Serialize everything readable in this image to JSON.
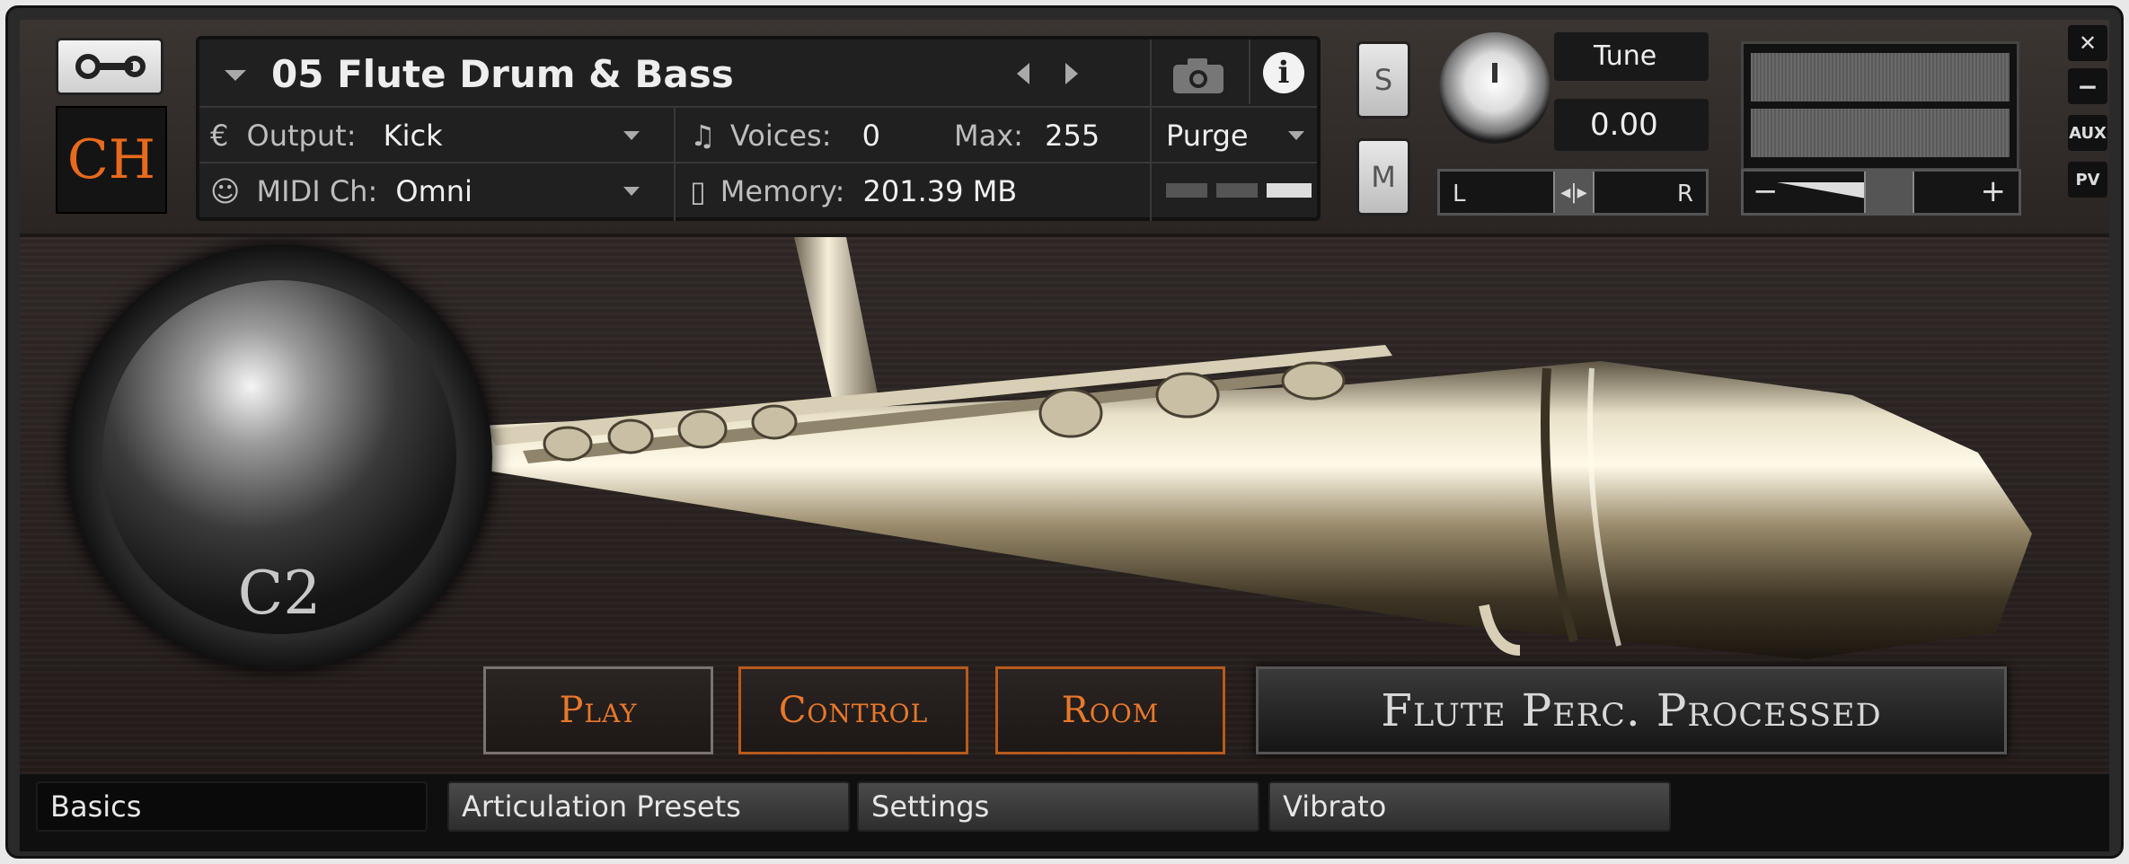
{
  "header": {
    "logo_text": "CH",
    "instrument_name": "05 Flute Drum & Bass",
    "output_label": "Output:",
    "output_value": "Kick",
    "midi_label": "MIDI Ch:",
    "midi_value": "Omni",
    "voices_label": "Voices:",
    "voices_value": "0",
    "max_label": "Max:",
    "max_value": "255",
    "memory_label": "Memory:",
    "memory_value": "201.39 MB",
    "purge_label": "Purge",
    "solo_label": "S",
    "mute_label": "M",
    "tune_label": "Tune",
    "tune_value": "0.00",
    "pan_left": "L",
    "pan_right": "R",
    "vol_minus": "−",
    "vol_plus": "+",
    "close_label": "✕",
    "minimize_label": "−",
    "aux_label": "AUX",
    "pv_label": "PV"
  },
  "main": {
    "note_label": "C2",
    "nav_buttons": [
      "Play",
      "Control",
      "Room"
    ],
    "preset_name": "Flute Perc. Processed"
  },
  "tabs": [
    "Basics",
    "Articulation Presets",
    "Settings",
    "Vibrato"
  ],
  "colors": {
    "accent": "#e86a1c",
    "panel": "#202020"
  }
}
